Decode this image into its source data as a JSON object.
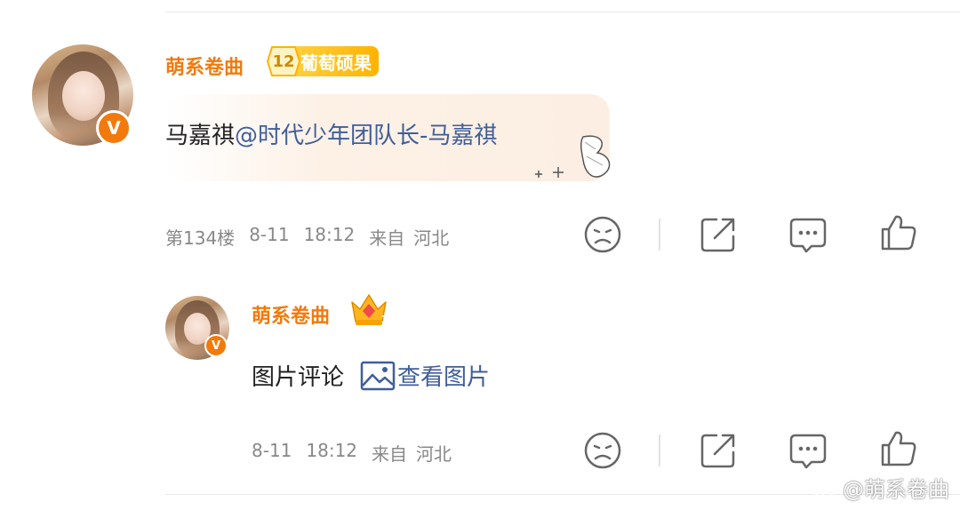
{
  "comment": {
    "username": "萌系卷曲",
    "level": "12",
    "badge_label": "葡萄硕果",
    "text_prefix": "马嘉祺",
    "mention": "@时代少年团队长-马嘉祺",
    "floor": "第134楼",
    "date": "8-11",
    "time": "18:12",
    "source": "来自",
    "location": "河北"
  },
  "reply": {
    "username": "萌系卷曲",
    "crown_level": "1",
    "text": "图片评论",
    "pic_link": "查看图片",
    "date": "8-11",
    "time": "18:12",
    "source": "来自",
    "location": "河北"
  },
  "verified_mark": "V",
  "watermark": "@萌系卷曲",
  "icons": [
    "dislike-face-icon",
    "share-icon",
    "comment-icon",
    "like-thumb-icon",
    "image-icon",
    "crown-icon",
    "verified-icon",
    "weibo-logo-icon"
  ],
  "colors": {
    "username": "#f27a0d",
    "mention": "#3f5e9a",
    "badge": "#ffbf1f",
    "meta": "#888888"
  }
}
